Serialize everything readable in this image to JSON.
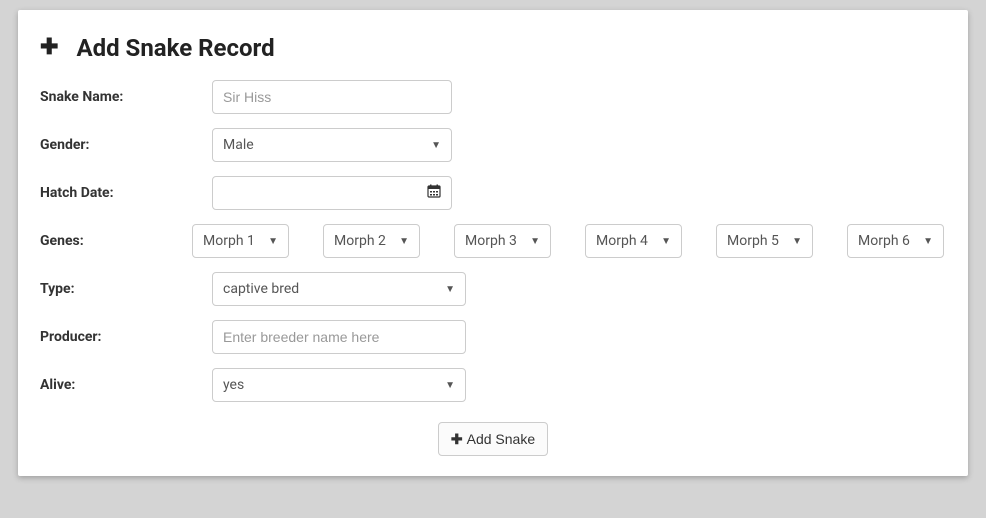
{
  "header": {
    "title": "Add Snake Record"
  },
  "form": {
    "snake_name": {
      "label": "Snake Name:",
      "placeholder": "Sir Hiss",
      "value": ""
    },
    "gender": {
      "label": "Gender:",
      "selected": "Male"
    },
    "hatch_date": {
      "label": "Hatch Date:",
      "value": ""
    },
    "genes": {
      "label": "Genes:",
      "morphs": [
        {
          "label": "Morph 1"
        },
        {
          "label": "Morph 2"
        },
        {
          "label": "Morph 3"
        },
        {
          "label": "Morph 4"
        },
        {
          "label": "Morph 5"
        },
        {
          "label": "Morph 6"
        }
      ]
    },
    "type": {
      "label": "Type:",
      "selected": "captive bred"
    },
    "producer": {
      "label": "Producer:",
      "placeholder": "Enter breeder name here",
      "value": ""
    },
    "alive": {
      "label": "Alive:",
      "selected": "yes"
    },
    "submit": {
      "label": "Add Snake"
    }
  }
}
